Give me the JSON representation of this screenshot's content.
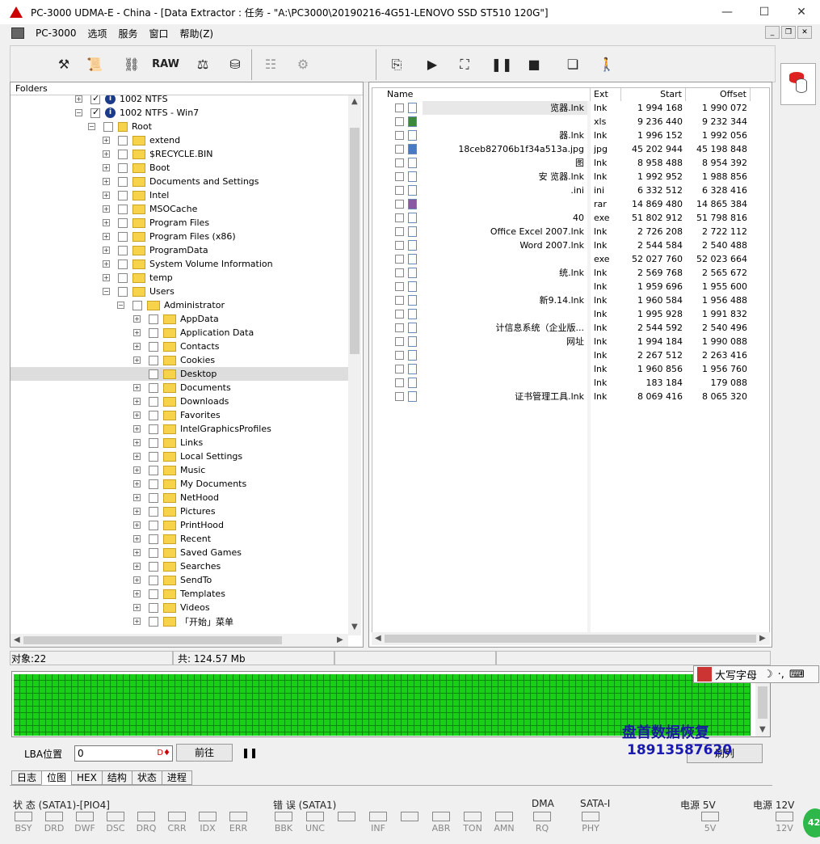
{
  "window": {
    "title": "PC-3000 UDMA-E - China - [Data Extractor : 任务 - \"A:\\PC3000\\20190216-4G51-LENOVO SSD ST510 120G\"]",
    "minimize": "—",
    "maximize": "☐",
    "close": "✕"
  },
  "menu": [
    "PC-3000",
    "选项",
    "服务",
    "窗口",
    "帮助(Z)"
  ],
  "toolbar": {
    "raw_label": "RAW"
  },
  "folders": {
    "header": "Folders",
    "rows": [
      {
        "label": "1002 NTFS",
        "depth": 0,
        "info": true,
        "checked": true,
        "pm": "+"
      },
      {
        "label": "1002 NTFS - Win7",
        "depth": 0,
        "info": true,
        "checked": true,
        "pm": "−"
      },
      {
        "label": "Root",
        "depth": 1,
        "root": true,
        "pm": "−"
      },
      {
        "label": "extend",
        "depth": 2,
        "pm": "+"
      },
      {
        "label": "$RECYCLE.BIN",
        "depth": 2,
        "pm": "+"
      },
      {
        "label": "Boot",
        "depth": 2,
        "pm": "+"
      },
      {
        "label": "Documents and Settings",
        "depth": 2,
        "pm": "+"
      },
      {
        "label": "Intel",
        "depth": 2,
        "pm": "+"
      },
      {
        "label": "MSOCache",
        "depth": 2,
        "pm": "+"
      },
      {
        "label": "Program Files",
        "depth": 2,
        "pm": "+"
      },
      {
        "label": "Program Files (x86)",
        "depth": 2,
        "pm": "+"
      },
      {
        "label": "ProgramData",
        "depth": 2,
        "pm": "+"
      },
      {
        "label": "System Volume Information",
        "depth": 2,
        "pm": "+"
      },
      {
        "label": "temp",
        "depth": 2,
        "pm": "+"
      },
      {
        "label": "Users",
        "depth": 2,
        "pm": "−"
      },
      {
        "label": "Administrator",
        "depth": 3,
        "pm": "−"
      },
      {
        "label": "AppData",
        "depth": 4,
        "pm": "+"
      },
      {
        "label": "Application Data",
        "depth": 4,
        "pm": "+"
      },
      {
        "label": "Contacts",
        "depth": 4,
        "pm": "+"
      },
      {
        "label": "Cookies",
        "depth": 4,
        "pm": "+"
      },
      {
        "label": "Desktop",
        "depth": 4,
        "pm": "",
        "selected": true
      },
      {
        "label": "Documents",
        "depth": 4,
        "pm": "+"
      },
      {
        "label": "Downloads",
        "depth": 4,
        "pm": "+"
      },
      {
        "label": "Favorites",
        "depth": 4,
        "pm": "+"
      },
      {
        "label": "IntelGraphicsProfiles",
        "depth": 4,
        "pm": "+"
      },
      {
        "label": "Links",
        "depth": 4,
        "pm": "+"
      },
      {
        "label": "Local Settings",
        "depth": 4,
        "pm": "+"
      },
      {
        "label": "Music",
        "depth": 4,
        "pm": "+"
      },
      {
        "label": "My Documents",
        "depth": 4,
        "pm": "+"
      },
      {
        "label": "NetHood",
        "depth": 4,
        "pm": "+"
      },
      {
        "label": "Pictures",
        "depth": 4,
        "pm": "+"
      },
      {
        "label": "PrintHood",
        "depth": 4,
        "pm": "+"
      },
      {
        "label": "Recent",
        "depth": 4,
        "pm": "+"
      },
      {
        "label": "Saved Games",
        "depth": 4,
        "pm": "+"
      },
      {
        "label": "Searches",
        "depth": 4,
        "pm": "+"
      },
      {
        "label": "SendTo",
        "depth": 4,
        "pm": "+"
      },
      {
        "label": "Templates",
        "depth": 4,
        "pm": "+"
      },
      {
        "label": "Videos",
        "depth": 4,
        "pm": "+"
      },
      {
        "label": "「开始」菜单",
        "depth": 4,
        "pm": "+"
      }
    ]
  },
  "files": {
    "headers": {
      "name": "Name",
      "ext": "Ext",
      "start": "Start",
      "offset": "Offset"
    },
    "rows": [
      {
        "name": "览器.lnk",
        "ext": "lnk",
        "start": "1 994 168",
        "offset": "1 990 072"
      },
      {
        "name": "",
        "ext": "xls",
        "start": "9 236 440",
        "offset": "9 232 344"
      },
      {
        "name": "器.lnk",
        "ext": "lnk",
        "start": "1 996 152",
        "offset": "1 992 056"
      },
      {
        "name": "18ceb82706b1f34a513a.jpg",
        "ext": "jpg",
        "start": "45 202 944",
        "offset": "45 198 848"
      },
      {
        "name": "图",
        "ext": "lnk",
        "start": "8 958 488",
        "offset": "8 954 392"
      },
      {
        "name": "安 览器.lnk",
        "ext": "lnk",
        "start": "1 992 952",
        "offset": "1 988 856"
      },
      {
        "name": ".ini",
        "ext": "ini",
        "start": "6 332 512",
        "offset": "6 328 416"
      },
      {
        "name": "",
        "ext": "rar",
        "start": "14 869 480",
        "offset": "14 865 384"
      },
      {
        "name": "40",
        "ext": "exe",
        "start": "51 802 912",
        "offset": "51 798 816"
      },
      {
        "name": "Office Excel 2007.lnk",
        "ext": "lnk",
        "start": "2 726 208",
        "offset": "2 722 112"
      },
      {
        "name": "Word 2007.lnk",
        "ext": "lnk",
        "start": "2 544 584",
        "offset": "2 540 488"
      },
      {
        "name": "",
        "ext": "exe",
        "start": "52 027 760",
        "offset": "52 023 664"
      },
      {
        "name": "统.lnk",
        "ext": "lnk",
        "start": "2 569 768",
        "offset": "2 565 672"
      },
      {
        "name": "",
        "ext": "lnk",
        "start": "1 959 696",
        "offset": "1 955 600"
      },
      {
        "name": "新9.14.lnk",
        "ext": "lnk",
        "start": "1 960 584",
        "offset": "1 956 488"
      },
      {
        "name": "",
        "ext": "lnk",
        "start": "1 995 928",
        "offset": "1 991 832"
      },
      {
        "name": "计信息系统（企业版...",
        "ext": "lnk",
        "start": "2 544 592",
        "offset": "2 540 496"
      },
      {
        "name": "网址",
        "ext": "lnk",
        "start": "1 994 184",
        "offset": "1 990 088"
      },
      {
        "name": "",
        "ext": "lnk",
        "start": "2 267 512",
        "offset": "2 263 416"
      },
      {
        "name": "",
        "ext": "lnk",
        "start": "1 960 856",
        "offset": "1 956 760"
      },
      {
        "name": "",
        "ext": "lnk",
        "start": "183 184",
        "offset": "179 088"
      },
      {
        "name": "证书管理工具.lnk",
        "ext": "lnk",
        "start": "8 069 416",
        "offset": "8 065 320"
      }
    ]
  },
  "status": {
    "objects": "对象:22",
    "total": "共: 124.57 Mb"
  },
  "ime": {
    "label": "大写字母"
  },
  "lba": {
    "label": "LBA位置",
    "value": "0",
    "go_button": "前往",
    "right_button": "刷列"
  },
  "tabs": [
    "日志",
    "位图",
    "HEX",
    "结构",
    "状态",
    "进程"
  ],
  "watermark": {
    "line1": "盘首数据恢复",
    "line2": "18913587620"
  },
  "leds": {
    "state_title": "状 态 (SATA1)-[PIO4]",
    "state": [
      "BSY",
      "DRD",
      "DWF",
      "DSC",
      "DRQ",
      "CRR",
      "IDX",
      "ERR"
    ],
    "error_title": "错 误 (SATA1)",
    "error": [
      "BBK",
      "UNC",
      "",
      "INF",
      "",
      "ABR",
      "TON",
      "AMN"
    ],
    "dma_title": "DMA",
    "dma": [
      "RQ"
    ],
    "sata_title": "SATA-I",
    "sata": [
      "PHY"
    ],
    "p5_title": "电源 5V",
    "p5": [
      "5V"
    ],
    "p12_title": "电源 12V",
    "p12": [
      "12V"
    ]
  },
  "badge": "42"
}
